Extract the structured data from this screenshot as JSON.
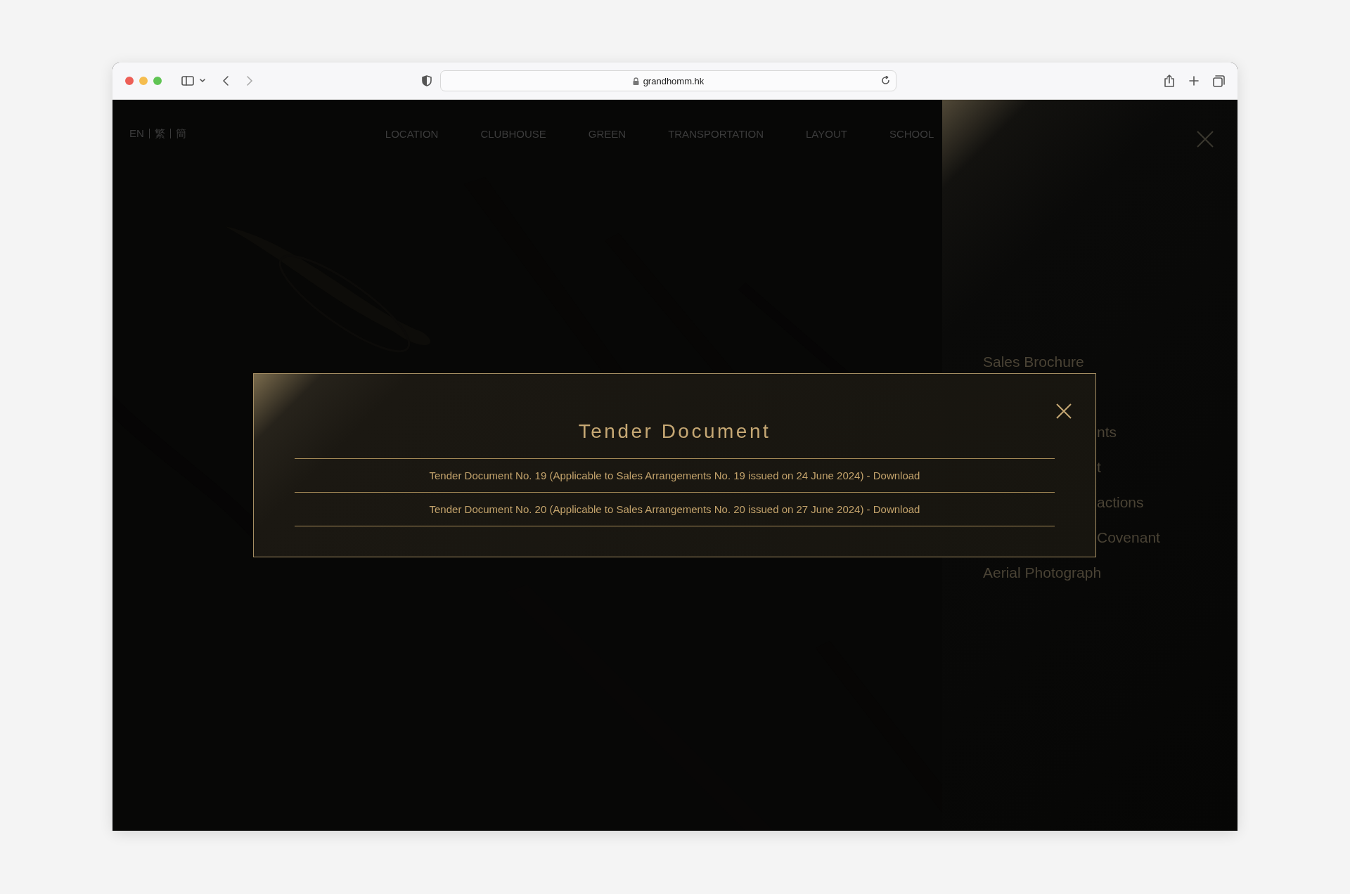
{
  "browser": {
    "url": "grandhomm.hk"
  },
  "languages": [
    "EN",
    "繁",
    "簡"
  ],
  "nav": [
    "LOCATION",
    "CLUBHOUSE",
    "GREEN",
    "TRANSPORTATION",
    "LAYOUT",
    "SCHOOL"
  ],
  "side_menu": {
    "items": [
      {
        "label": "Sales Brochure",
        "kind": "full"
      },
      {
        "label": "nts",
        "kind": "cut"
      },
      {
        "label": "t",
        "kind": "cut"
      },
      {
        "label": "actions",
        "kind": "cut"
      },
      {
        "label": "Covenant",
        "kind": "cut"
      },
      {
        "label": "Aerial Photograph",
        "kind": "full"
      }
    ]
  },
  "modal": {
    "title": "Tender Document",
    "links": [
      "Tender Document No. 19 (Applicable to Sales Arrangements No. 19 issued on 24 June 2024) - Download",
      "Tender Document No. 20 (Applicable to Sales Arrangements No. 20 issued on 27 June 2024) - Download"
    ]
  }
}
